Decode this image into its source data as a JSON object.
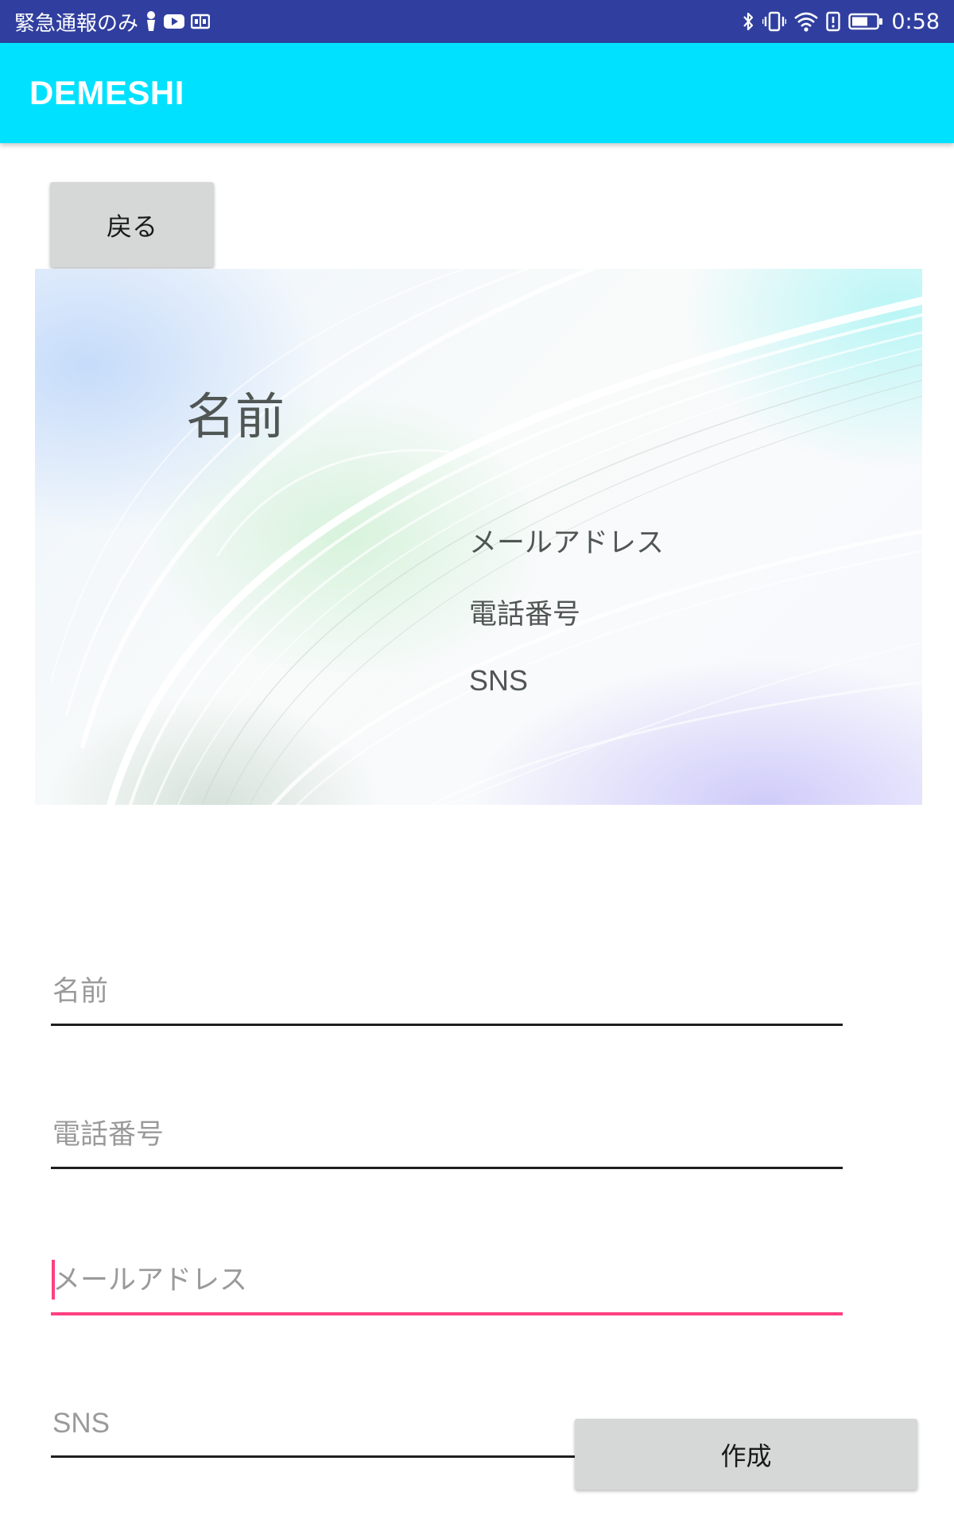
{
  "status_bar": {
    "carrier_text": "緊急通報のみ",
    "time": "0:58",
    "icons": [
      "person-icon",
      "youtube-icon",
      "book-icon",
      "bluetooth-icon",
      "vibrate-icon",
      "wifi-icon",
      "alert-icon",
      "battery-icon"
    ]
  },
  "app_bar": {
    "title": "DEMESHI",
    "color": "#00e1ff"
  },
  "back_button": {
    "label": "戻る"
  },
  "card_preview": {
    "name": "名前",
    "email": "メールアドレス",
    "phone": "電話番号",
    "sns": "SNS"
  },
  "form": {
    "name_placeholder": "名前",
    "phone_placeholder": "電話番号",
    "email_placeholder": "メールアドレス",
    "sns_placeholder": "SNS",
    "focused_field": "email",
    "accent_color": "#ff4081"
  },
  "create_button": {
    "label": "作成"
  }
}
